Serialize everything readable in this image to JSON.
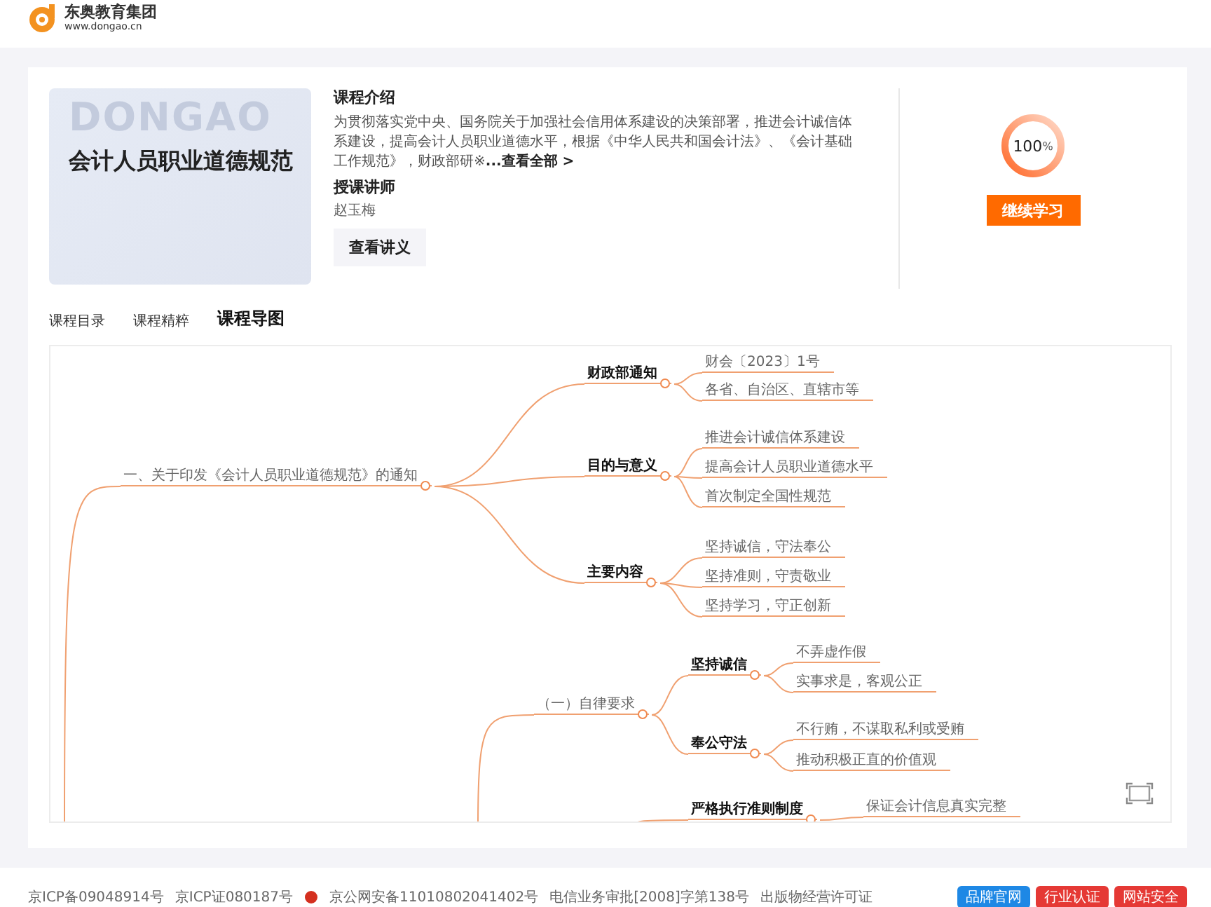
{
  "header": {
    "logo_title": "东奥教育集团",
    "logo_url": "www.dongao.cn"
  },
  "course": {
    "cover_watermark": "DONGAO",
    "cover_title": "会计人员职业道德规范",
    "intro_heading": "课程介绍",
    "intro_text": "为贯彻落实党中央、国务院关于加强社会信用体系建设的决策部署，推进会计诚信体系建设，提高会计人员职业道德水平，根据《中华人民共和国会计法》、《会计基础工作规范》，财政部研※",
    "intro_more": "...查看全部 >",
    "teacher_heading": "授课讲师",
    "teacher": "赵玉梅",
    "handout_button": "查看讲义",
    "progress": {
      "level": 1,
      "value": "100",
      "unit": "%"
    },
    "continue_button": "继续学习"
  },
  "tabs": [
    {
      "label": "课程目录",
      "selected": false
    },
    {
      "label": "课程精粹",
      "selected": false
    },
    {
      "label": "课程导图",
      "selected": true
    }
  ],
  "mind_map": {
    "nodes": [
      {
        "text": "一、关于印发《会计人员职业道德规范》的通知",
        "kind": "plain",
        "children": [
          {
            "text": "财政部通知",
            "kind": "bold",
            "children": [
              {
                "text": "财会〔2023〕1号",
                "kind": "plain"
              },
              {
                "text": "各省、自治区、直辖市等",
                "kind": "plain"
              }
            ]
          },
          {
            "text": "目的与意义",
            "kind": "bold",
            "children": [
              {
                "text": "推进会计诚信体系建设",
                "kind": "plain"
              },
              {
                "text": "提高会计人员职业道德水平",
                "kind": "plain"
              },
              {
                "text": "首次制定全国性规范",
                "kind": "plain"
              }
            ]
          },
          {
            "text": "主要内容",
            "kind": "bold",
            "children": [
              {
                "text": "坚持诚信，守法奉公",
                "kind": "plain"
              },
              {
                "text": "坚持准则，守责敬业",
                "kind": "plain"
              },
              {
                "text": "坚持学习，守正创新",
                "kind": "plain"
              }
            ]
          }
        ]
      },
      {
        "text": "（一）自律要求",
        "kind": "plain",
        "children": [
          {
            "text": "坚持诚信",
            "kind": "bold",
            "children": [
              {
                "text": "不弄虚作假",
                "kind": "plain"
              },
              {
                "text": "实事求是，客观公正",
                "kind": "plain"
              }
            ]
          },
          {
            "text": "奉公守法",
            "kind": "bold",
            "children": [
              {
                "text": "不行贿，不谋取私利或受贿",
                "kind": "plain"
              },
              {
                "text": "推动积极正直的价值观",
                "kind": "plain"
              }
            ]
          }
        ]
      },
      {
        "text": "严格执行准则制度",
        "kind": "bold",
        "children": [
          {
            "text": "保证会计信息真实完整",
            "kind": "plain"
          }
        ]
      }
    ]
  },
  "footer": {
    "records": [
      "京ICP备09048914号",
      "京ICP证080187号",
      "京公网安备11010802041402号",
      "电信业务审批[2008]字第138号",
      "出版物经营许可证"
    ],
    "badges": [
      {
        "text": "品牌官网",
        "color": "#1e88e5"
      },
      {
        "text": "行业认证",
        "color": "#e53935"
      },
      {
        "text": "网站安全",
        "color": "#e53935"
      }
    ]
  }
}
